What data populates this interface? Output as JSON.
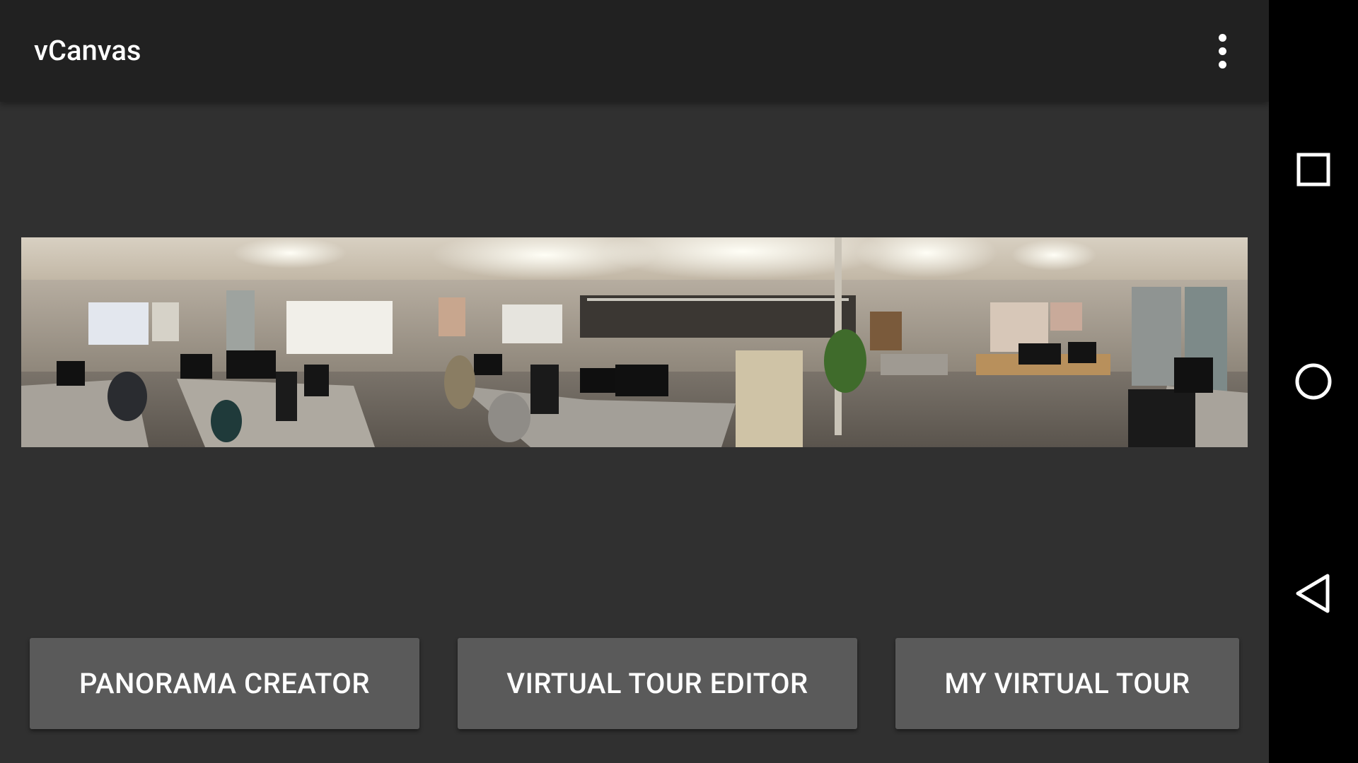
{
  "app_bar": {
    "title": "vCanvas",
    "overflow_icon": "more-vert-icon"
  },
  "panorama": {
    "subject": "panoramic-office-photo"
  },
  "buttons": {
    "panorama_creator": "PANORAMA CREATOR",
    "virtual_tour_editor": "VIRTUAL TOUR EDITOR",
    "my_virtual_tour": "MY VIRTUAL TOUR"
  },
  "nav_bar": {
    "recents_icon": "square-recents-icon",
    "home_icon": "circle-home-icon",
    "back_icon": "triangle-back-icon"
  },
  "colors": {
    "app_bar": "#212121",
    "background": "#303030",
    "button": "#5a5a5a",
    "text": "#ffffff",
    "nav_bar": "#000000"
  }
}
